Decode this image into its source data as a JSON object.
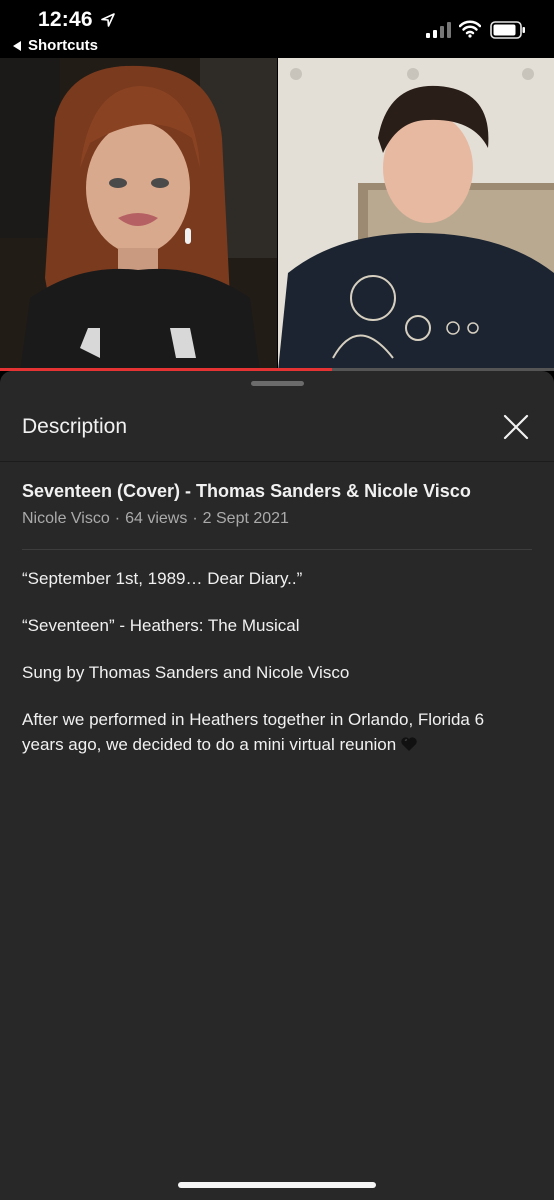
{
  "status_bar": {
    "time": "12:46",
    "back_label": "Shortcuts"
  },
  "video": {
    "progress_fraction": 0.6,
    "progress_color": "#e53232"
  },
  "description_panel": {
    "header_title": "Description",
    "video_title": "Seventeen (Cover) - Thomas Sanders & Nicole Visco",
    "channel": "Nicole Visco",
    "views": "64 views",
    "date": "2 Sept 2021",
    "separator": "·",
    "paragraphs": [
      "“September 1st, 1989… Dear Diary..”",
      "“Seventeen” - Heathers: The Musical",
      "Sung by Thomas Sanders and Nicole Visco",
      "After we performed in Heathers together in Orlando, Florida 6 years ago, we decided to do a mini virtual reunion"
    ],
    "paragraph_emoji": "black-heart-icon"
  },
  "colors": {
    "sheet_background": "#282828",
    "primary_text": "#f1f1f1",
    "secondary_text": "#aaaaaa"
  }
}
